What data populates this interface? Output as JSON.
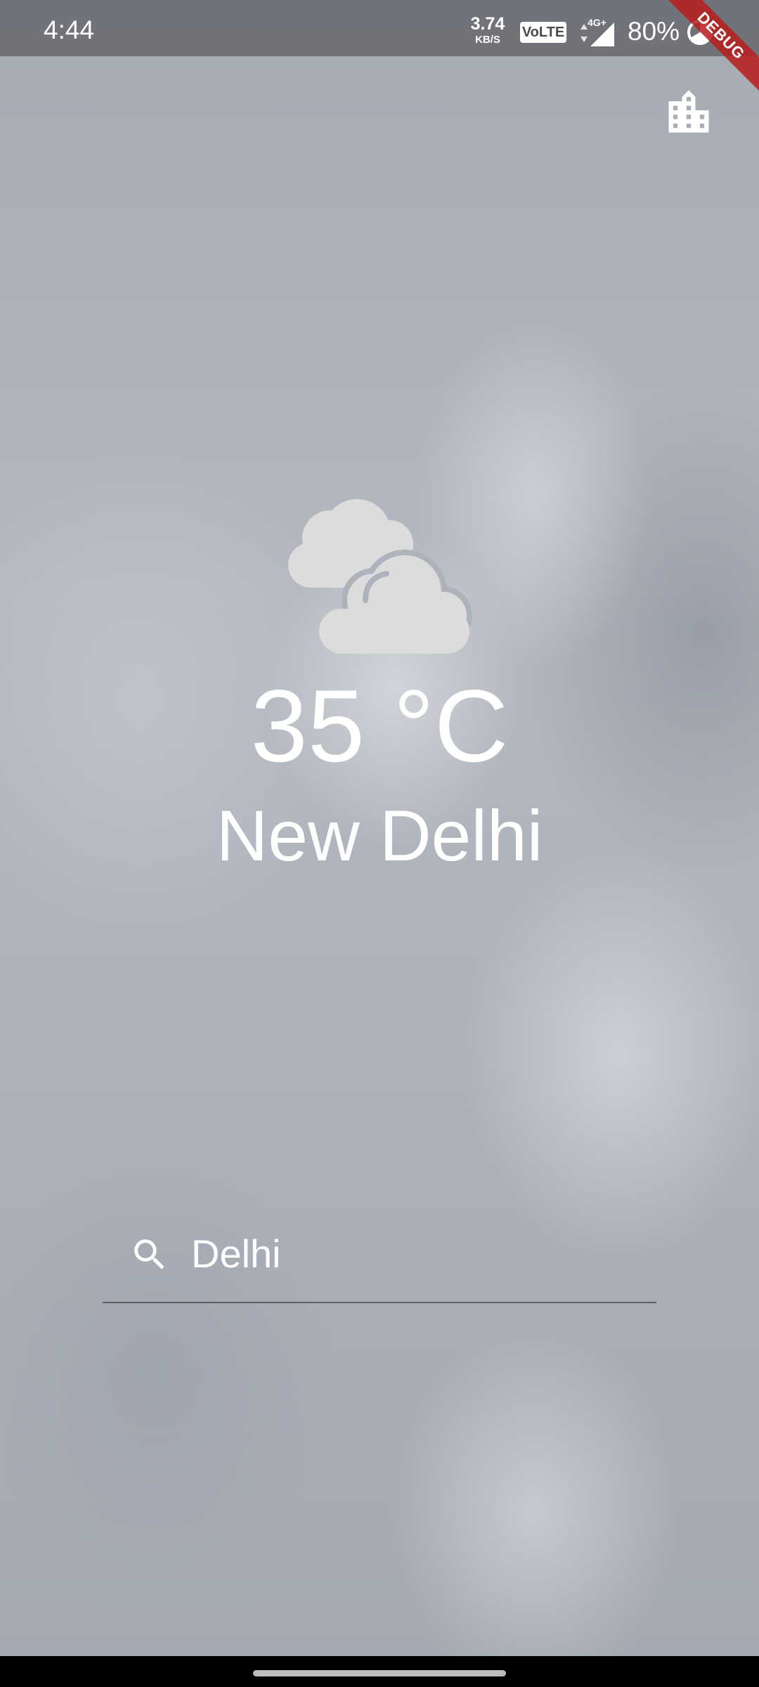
{
  "status_bar": {
    "time": "4:44",
    "net_speed_value": "3.74",
    "net_speed_unit": "KB/S",
    "volte_label": "VoLTE",
    "network_type": "4G+",
    "battery_percent": "80%",
    "signal_icon": "signal-strength-icon",
    "battery_icon": "battery-icon"
  },
  "debug_banner": {
    "label": "DEBUG"
  },
  "app_bar": {
    "city_button_icon": "city-buildings-icon"
  },
  "weather": {
    "condition_icon": "cloudy-icon",
    "temperature": "35 °C",
    "city": "New Delhi"
  },
  "search": {
    "icon": "search-icon",
    "value": "Delhi",
    "underline_color": "#5b6068"
  },
  "colors": {
    "text_primary": "#ffffff",
    "icon_fill": "#dcdcdc",
    "debug_ribbon": "#b71c1c"
  }
}
